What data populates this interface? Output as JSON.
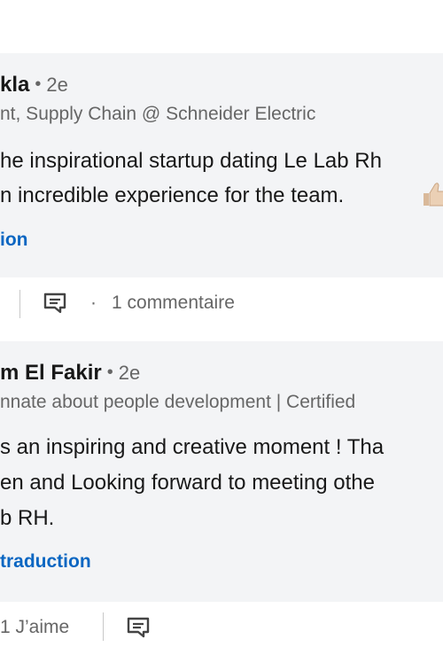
{
  "comments": [
    {
      "author": "kla",
      "degree": "2e",
      "headline": "nt, Supply Chain @ Schneider Electric",
      "body_lines": [
        "he inspirational startup dating Le Lab Rh",
        "n incredible experience for the team."
      ],
      "translate_link": "ion",
      "reply_count_label": "1 commentaire"
    },
    {
      "author": "m El Fakir",
      "degree": "2e",
      "headline": "nnate about people development | Certified",
      "body_lines": [
        "s an inspiring and creative moment ! Tha",
        "en and Looking forward to meeting othe",
        "b RH."
      ],
      "translate_link": "traduction",
      "like_label": "1 J’aime"
    }
  ],
  "separator_dot": "·",
  "colors": {
    "card_bg": "#f3f4f6",
    "link": "#0a66c2",
    "muted": "#666666"
  },
  "icons": {
    "comment": "comment-bubble-icon",
    "emoji": "thumbs-up-emoji-icon"
  }
}
